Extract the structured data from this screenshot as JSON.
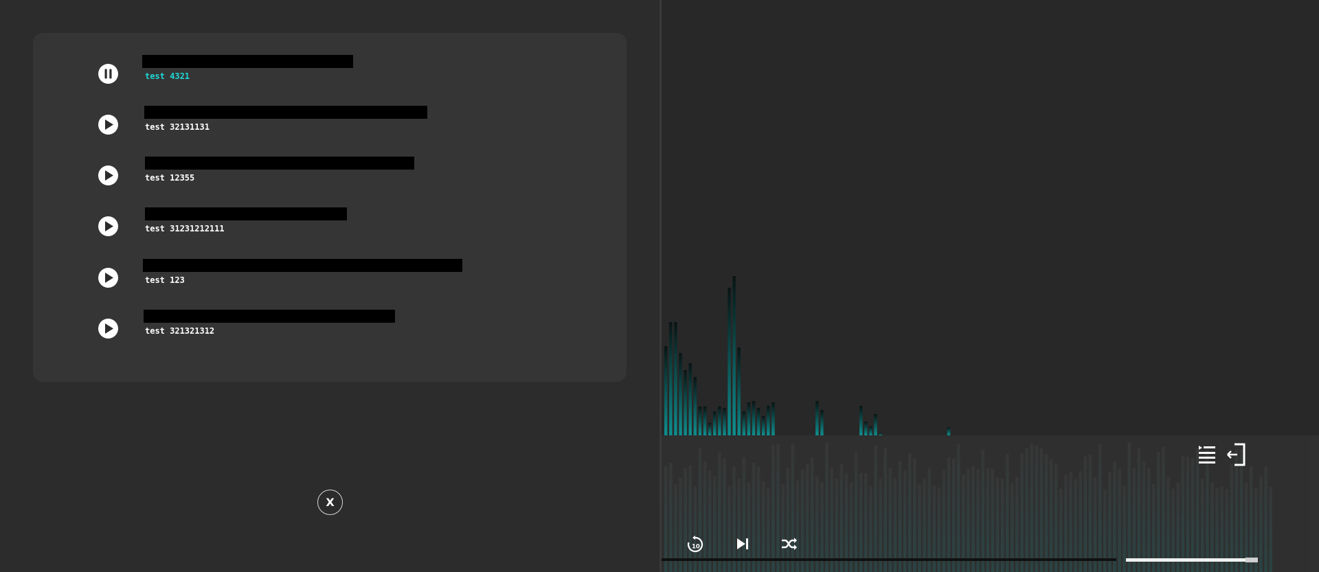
{
  "playlist": {
    "tracks": [
      {
        "label": "test 4321",
        "state": "playing",
        "icon": "pause-icon"
      },
      {
        "label": "test 32131131",
        "state": "paused",
        "icon": "play-icon"
      },
      {
        "label": "test 12355",
        "state": "paused",
        "icon": "play-icon"
      },
      {
        "label": "test 31231212111",
        "state": "paused",
        "icon": "play-icon"
      },
      {
        "label": "test 123",
        "state": "paused",
        "icon": "play-icon"
      },
      {
        "label": "test 321321312",
        "state": "paused",
        "icon": "play-icon"
      }
    ]
  },
  "close_button": {
    "label": "X"
  },
  "player": {
    "controls": [
      {
        "name": "replay-10-button",
        "icon": "replay-10-icon",
        "label": "10"
      },
      {
        "name": "skip-next-button",
        "icon": "skip-next-icon"
      },
      {
        "name": "shuffle-button",
        "icon": "shuffle-icon"
      },
      {
        "name": "playlist-button",
        "icon": "playlist-icon"
      },
      {
        "name": "exit-button",
        "icon": "exit-icon"
      }
    ],
    "volume_fraction": 0.96
  },
  "colors": {
    "accent": "#1fd6d6",
    "visualizer": "#0f8f8f"
  }
}
